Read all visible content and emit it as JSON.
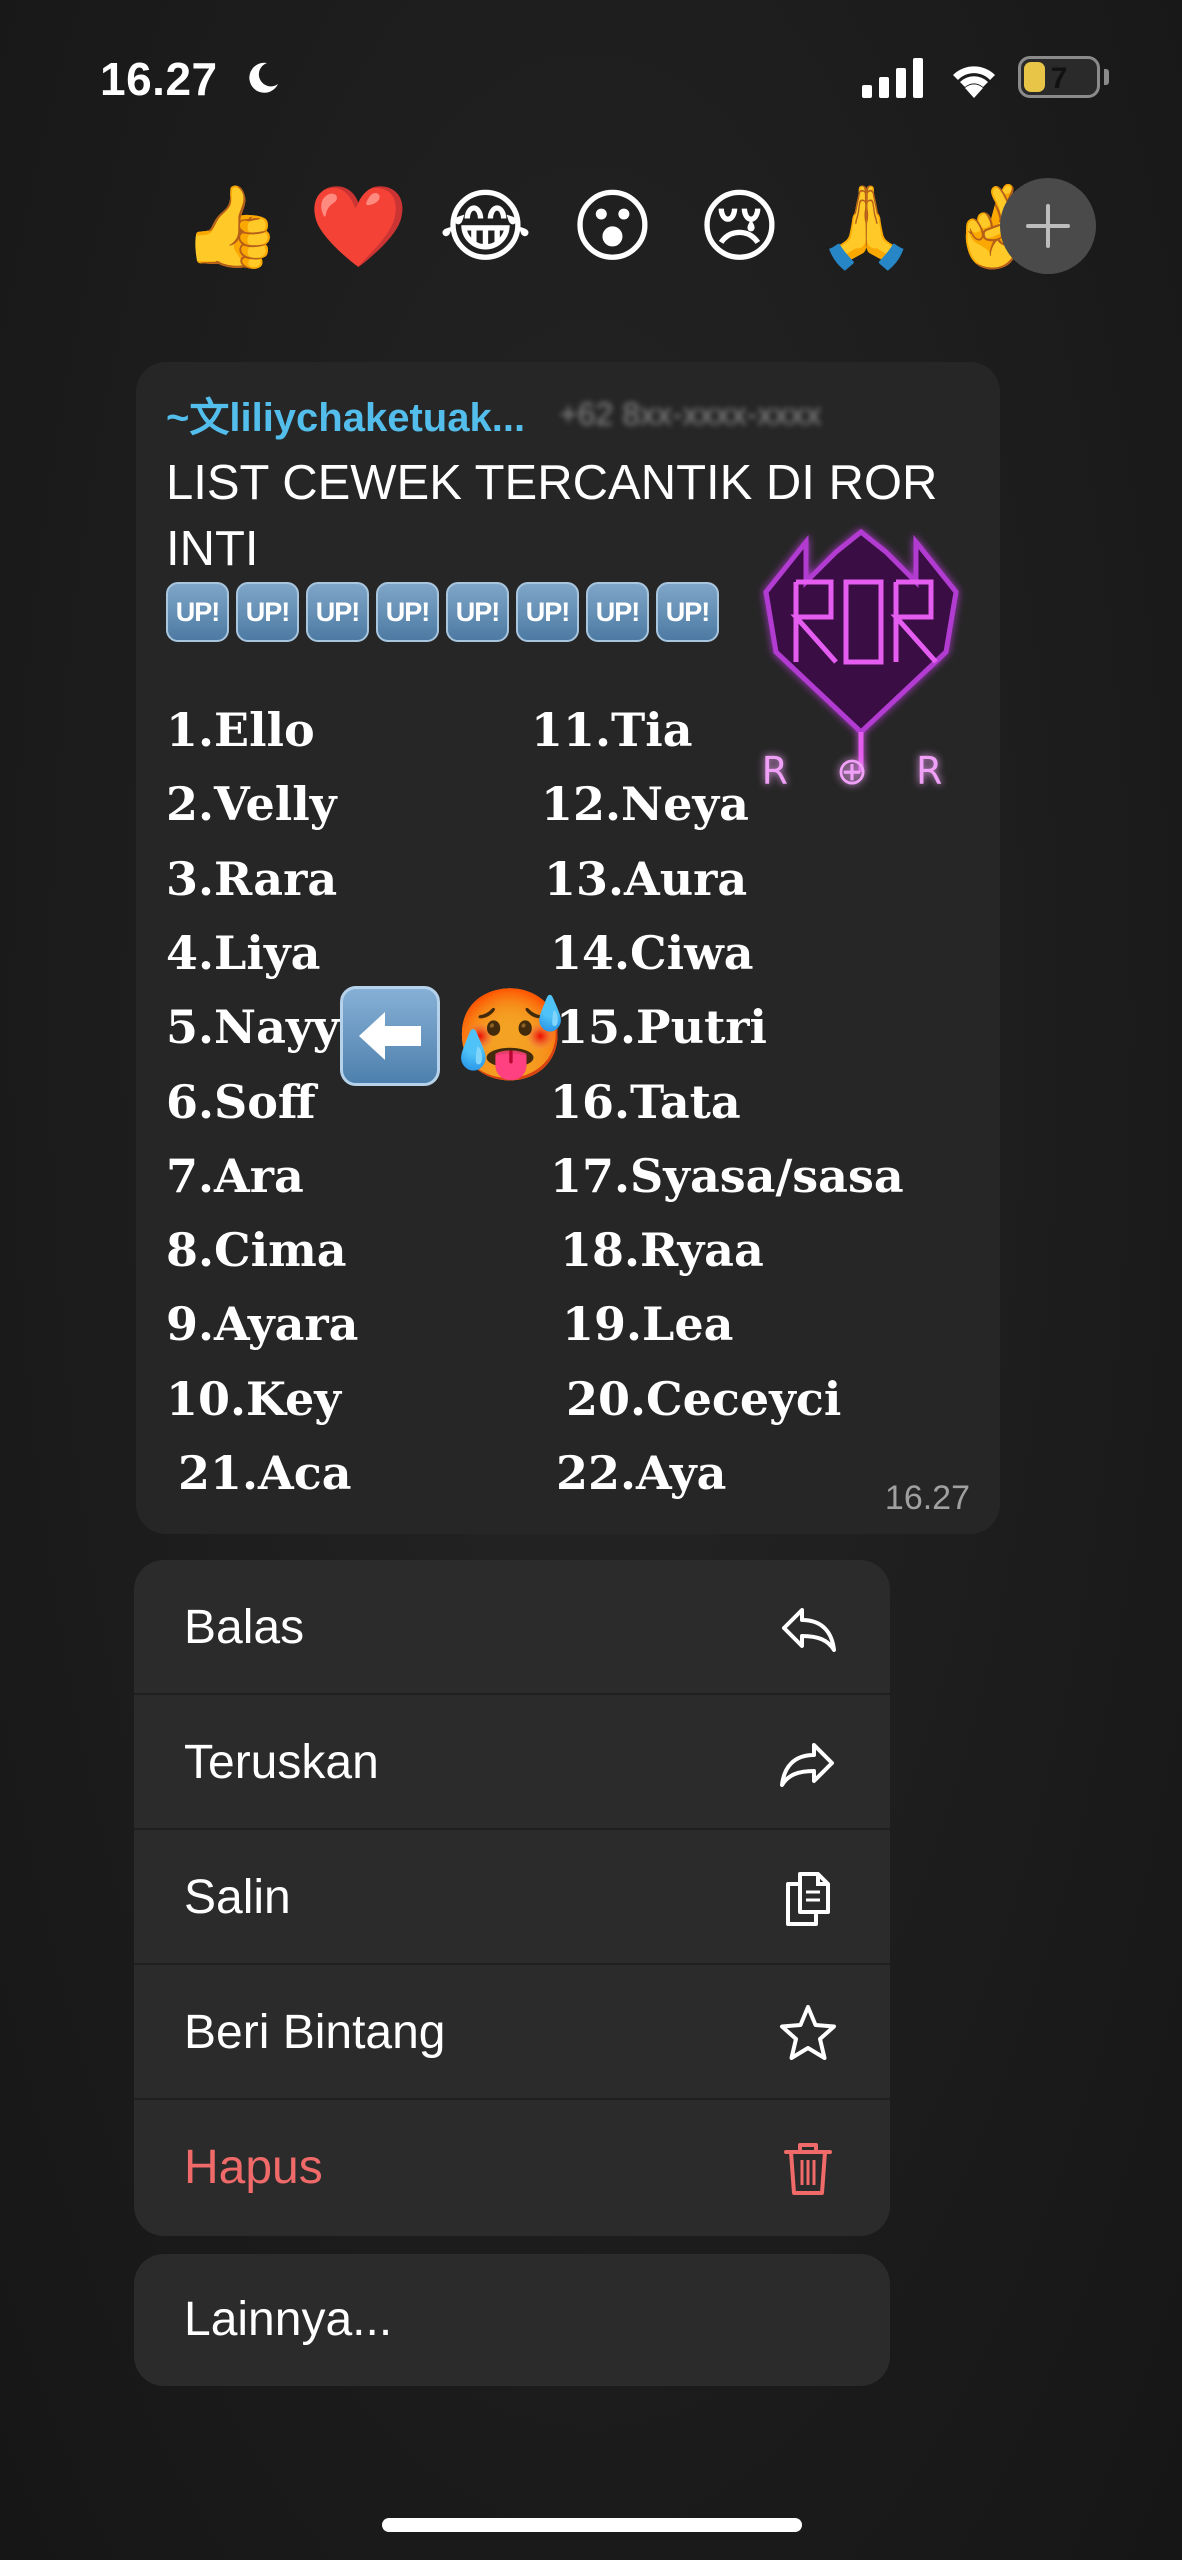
{
  "status_bar": {
    "time": "16.27",
    "battery_level": "7",
    "battery_fraction": 0.3
  },
  "reactions": [
    {
      "emoji": "👍",
      "name": "thumbs-up"
    },
    {
      "emoji": "❤️",
      "name": "red-heart"
    },
    {
      "emoji": "😂",
      "name": "tears-of-joy"
    },
    {
      "emoji": "😮",
      "name": "surprised"
    },
    {
      "emoji": "😢",
      "name": "crying"
    },
    {
      "emoji": "🙏",
      "name": "folded-hands"
    },
    {
      "emoji": "🤞",
      "name": "partial-emoji"
    }
  ],
  "message": {
    "sender": "~文liliychaketuak...",
    "sender_phone": "+62 8xx-xxxx-xxxx",
    "title": "LIST CEWEK TERCANTIK DI ROR INTI",
    "up_badge": "UP!",
    "up_badge_count": 8,
    "logo_letters": "R ⊕ R",
    "list_left": [
      "1.Ello",
      "2.Velly",
      "3.Rara",
      "4.Liya",
      "5.Nayy",
      "6.Soff",
      "7.Ara",
      "8.Cima",
      "9.Ayara",
      "10.Key",
      "21.Aca"
    ],
    "list_right": [
      "11.Tia",
      "12.Neya",
      "13.Aura",
      "14.Ciwa",
      "15.Putri",
      "16.Tata",
      "17.Syasa/sasa",
      "18.Ryaa",
      "19.Lea",
      "20.Ceceyci",
      "22.Aya"
    ],
    "arrow_emoji": "⬅",
    "hot_emoji": "🥵",
    "time": "16.27"
  },
  "menu": {
    "items": [
      {
        "label": "Balas",
        "icon": "reply-icon"
      },
      {
        "label": "Teruskan",
        "icon": "forward-icon"
      },
      {
        "label": "Salin",
        "icon": "copy-icon"
      },
      {
        "label": "Beri Bintang",
        "icon": "star-icon"
      },
      {
        "label": "Hapus",
        "icon": "trash-icon"
      }
    ],
    "more_label": "Lainnya..."
  },
  "colors": {
    "background": "#1c1c1c",
    "bubble": "#262626",
    "sender_name": "#53bdeb",
    "danger": "#f06a6a",
    "battery": "#e8c547"
  }
}
